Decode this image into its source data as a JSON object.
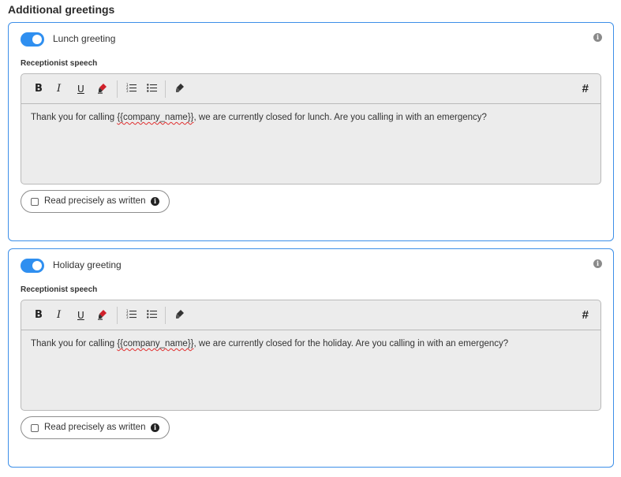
{
  "section_title": "Additional greetings",
  "colors": {
    "accent": "#2f8ff0",
    "card_border": "#3d8fe8",
    "editor_bg": "#ececec",
    "highlight_icon": "#d0202a"
  },
  "toolbar": {
    "bold": "B",
    "italic": "I",
    "underline": "U",
    "highlight_icon": "highlighter-icon",
    "ordered_list_icon": "ordered-list-icon",
    "unordered_list_icon": "unordered-list-icon",
    "clear_format_icon": "eraser-icon",
    "variable": "#"
  },
  "greetings": [
    {
      "enabled": true,
      "label": "Lunch greeting",
      "speech_label": "Receptionist speech",
      "text_before": "Thank you for calling ",
      "text_variable": "{{company_name}}",
      "text_after": ", we are currently closed for lunch. Are you calling in with an emergency?",
      "read_precisely_label": "Read precisely as written",
      "read_precisely_checked": false
    },
    {
      "enabled": true,
      "label": "Holiday greeting",
      "speech_label": "Receptionist speech",
      "text_before": "Thank you for calling ",
      "text_variable": "{{company_name}}",
      "text_after": ", we are currently closed for the holiday. Are you calling in with an emergency?",
      "read_precisely_label": "Read precisely as written",
      "read_precisely_checked": false
    }
  ]
}
